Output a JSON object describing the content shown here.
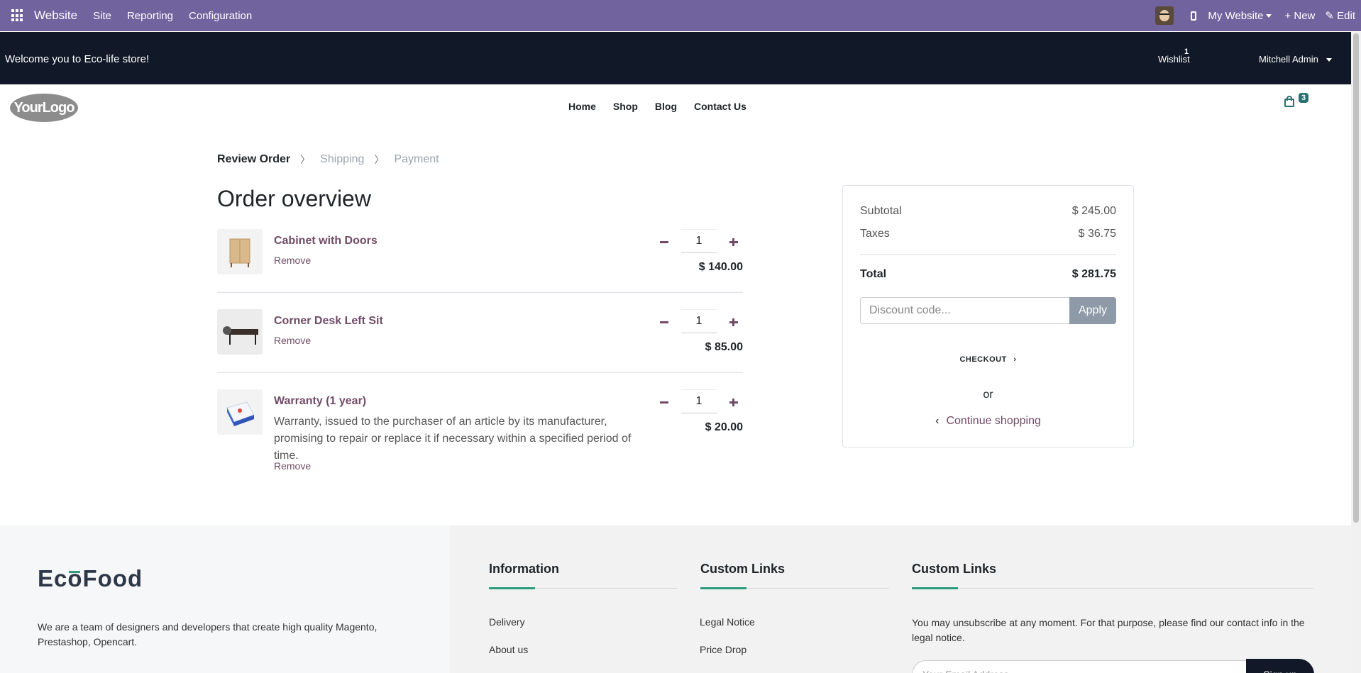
{
  "adminbar": {
    "brand": "Website",
    "menus": [
      "Site",
      "Reporting",
      "Configuration"
    ],
    "website_selector": "My Website",
    "new_label": "+ New",
    "edit_label": "Edit"
  },
  "topbar": {
    "welcome": "Welcome you to Eco-life store!",
    "wishlist_label": "Wishlist",
    "wishlist_count": "1",
    "user": "Mitchell Admin"
  },
  "nav": {
    "logo_text": "YourLogo",
    "links": [
      "Home",
      "Shop",
      "Blog",
      "Contact Us"
    ],
    "cart_count": "3"
  },
  "steps": [
    "Review Order",
    "Shipping",
    "Payment"
  ],
  "title": "Order overview",
  "lines": [
    {
      "name": "Cabinet with Doors",
      "description": "",
      "remove": "Remove",
      "qty": "1",
      "price": "$ 140.00"
    },
    {
      "name": "Corner Desk Left Sit",
      "description": "",
      "remove": "Remove",
      "qty": "1",
      "price": "$ 85.00"
    },
    {
      "name": "Warranty (1 year)",
      "description": "Warranty, issued to the purchaser of an article by its manufacturer, promising to repair or replace it if necessary within a specified period of time.",
      "remove": "Remove",
      "qty": "1",
      "price": "$ 20.00"
    }
  ],
  "summary": {
    "subtotal_label": "Subtotal",
    "subtotal": "$ 245.00",
    "taxes_label": "Taxes",
    "taxes": "$ 36.75",
    "total_label": "Total",
    "total": "$ 281.75",
    "discount_placeholder": "Discount code...",
    "apply_label": "Apply",
    "checkout_label": "CHECKOUT",
    "or_label": "or",
    "continue_label": "Continue shopping"
  },
  "footer": {
    "brand": "EcoFood",
    "about": "We are a team of designers and developers that create high quality Magento, Prestashop, Opencart.",
    "col1_title": "Information",
    "col1_links": [
      "Delivery",
      "About us"
    ],
    "col2_title": "Custom Links",
    "col2_links": [
      "Legal Notice",
      "Price Drop"
    ],
    "col3_title": "Custom Links",
    "newsletter_text": "You may unsubscribe at any moment. For that purpose, please find our contact info in the legal notice.",
    "email_placeholder": "Your Email Address",
    "signup_label": "Sign up"
  },
  "colors": {
    "admin_bar": "#71639e",
    "top_bar": "#111827",
    "accent": "#714b67",
    "teal": "#2a6f72",
    "footer_accent": "#2f9b7d"
  }
}
